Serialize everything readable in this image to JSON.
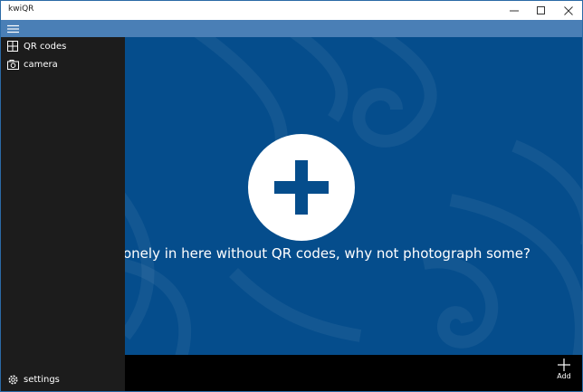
{
  "window": {
    "title": "kwiQR"
  },
  "colors": {
    "accent": "#054d8c",
    "header": "#4a7fb6",
    "sidebar": "#1c1c1c",
    "command_bar": "#000000"
  },
  "sidebar": {
    "items": [
      {
        "label": "QR codes",
        "icon": "grid-icon"
      },
      {
        "label": "camera",
        "icon": "camera-icon"
      }
    ],
    "footer": {
      "label": "settings",
      "icon": "gear-icon"
    }
  },
  "main": {
    "add_icon": "plus-icon",
    "empty_message": "onely in here without QR codes, why not photograph some?"
  },
  "command_bar": {
    "add_label": "Add"
  }
}
